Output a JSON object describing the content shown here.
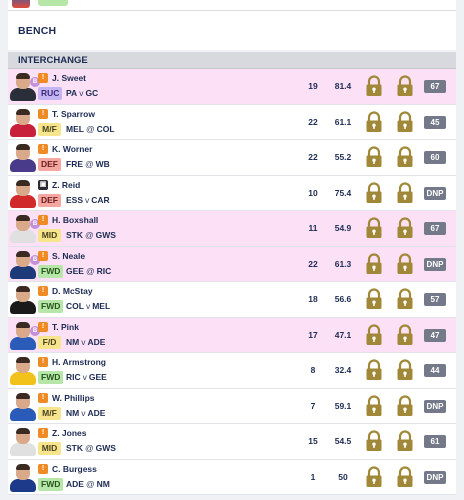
{
  "bench": {
    "label": "BENCH"
  },
  "section": {
    "label": "INTERCHANGE"
  },
  "position_colors": {
    "RUC": {
      "bg": "#c5b4f2",
      "fg": "#3a2c7a"
    },
    "M/F": {
      "bg": "#f6e58c",
      "fg": "#4a4220"
    },
    "DEF": {
      "bg": "#f4a6a0",
      "fg": "#6e2020"
    },
    "MID": {
      "bg": "#f6e58c",
      "fg": "#4a4220"
    },
    "FWD": {
      "bg": "#b6e6a8",
      "fg": "#27571d"
    },
    "F/D": {
      "bg": "#f6e58c",
      "fg": "#4a4220"
    }
  },
  "players": [
    {
      "name": "J. Sweet",
      "status_icon": "injury-icon",
      "status_glyph": "!",
      "flag": "B",
      "position": "RUC",
      "team": "PA",
      "sep": "v",
      "opponent": "GC",
      "v1": "19",
      "v2": "81.4",
      "badge": "67",
      "highlight": true,
      "jersey": "#2a2e38"
    },
    {
      "name": "T. Sparrow",
      "status_icon": "injury-icon",
      "status_glyph": "!",
      "flag": "",
      "position": "M/F",
      "team": "MEL",
      "sep": "@",
      "opponent": "COL",
      "v1": "22",
      "v2": "61.1",
      "badge": "45",
      "highlight": false,
      "jersey": "#c8203a"
    },
    {
      "name": "K. Worner",
      "status_icon": "injury-icon",
      "status_glyph": "!",
      "flag": "",
      "position": "DEF",
      "team": "FRE",
      "sep": "@",
      "opponent": "WB",
      "v1": "22",
      "v2": "55.2",
      "badge": "60",
      "highlight": false,
      "jersey": "#4a3a8a"
    },
    {
      "name": "Z. Reid",
      "status_icon": "calendar-icon",
      "status_glyph": "▣",
      "flag": "",
      "position": "DEF",
      "team": "ESS",
      "sep": "v",
      "opponent": "CAR",
      "v1": "10",
      "v2": "75.4",
      "badge": "DNP",
      "highlight": false,
      "jersey": "#d12a2a"
    },
    {
      "name": "H. Boxshall",
      "status_icon": "injury-icon",
      "status_glyph": "!",
      "flag": "B",
      "position": "MID",
      "team": "STK",
      "sep": "@",
      "opponent": "GWS",
      "v1": "11",
      "v2": "54.9",
      "badge": "67",
      "highlight": true,
      "jersey": "#e0e0e0"
    },
    {
      "name": "S. Neale",
      "status_icon": "injury-icon",
      "status_glyph": "!",
      "flag": "B",
      "position": "FWD",
      "team": "GEE",
      "sep": "@",
      "opponent": "RIC",
      "v1": "22",
      "v2": "61.3",
      "badge": "DNP",
      "highlight": true,
      "jersey": "#1f3a78"
    },
    {
      "name": "D. McStay",
      "status_icon": "injury-icon",
      "status_glyph": "!",
      "flag": "",
      "position": "FWD",
      "team": "COL",
      "sep": "v",
      "opponent": "MEL",
      "v1": "18",
      "v2": "56.6",
      "badge": "57",
      "highlight": false,
      "jersey": "#1a1a1a"
    },
    {
      "name": "T. Pink",
      "status_icon": "injury-icon",
      "status_glyph": "!",
      "flag": "B",
      "position": "F/D",
      "team": "NM",
      "sep": "v",
      "opponent": "ADE",
      "v1": "17",
      "v2": "47.1",
      "badge": "47",
      "highlight": true,
      "jersey": "#2a5bb8"
    },
    {
      "name": "H. Armstrong",
      "status_icon": "injury-icon",
      "status_glyph": "!",
      "flag": "",
      "position": "FWD",
      "team": "RIC",
      "sep": "v",
      "opponent": "GEE",
      "v1": "8",
      "v2": "32.4",
      "badge": "44",
      "highlight": false,
      "jersey": "#f2c21a"
    },
    {
      "name": "W. Phillips",
      "status_icon": "injury-icon",
      "status_glyph": "!",
      "flag": "",
      "position": "M/F",
      "team": "NM",
      "sep": "v",
      "opponent": "ADE",
      "v1": "7",
      "v2": "59.1",
      "badge": "DNP",
      "highlight": false,
      "jersey": "#2a5bb8"
    },
    {
      "name": "Z. Jones",
      "status_icon": "injury-icon",
      "status_glyph": "!",
      "flag": "",
      "position": "MID",
      "team": "STK",
      "sep": "@",
      "opponent": "GWS",
      "v1": "15",
      "v2": "54.5",
      "badge": "61",
      "highlight": false,
      "jersey": "#e0e0e0"
    },
    {
      "name": "C. Burgess",
      "status_icon": "injury-icon",
      "status_glyph": "!",
      "flag": "",
      "position": "FWD",
      "team": "ADE",
      "sep": "@",
      "opponent": "NM",
      "v1": "1",
      "v2": "50",
      "badge": "DNP",
      "highlight": false,
      "jersey": "#1d3a8a"
    }
  ]
}
